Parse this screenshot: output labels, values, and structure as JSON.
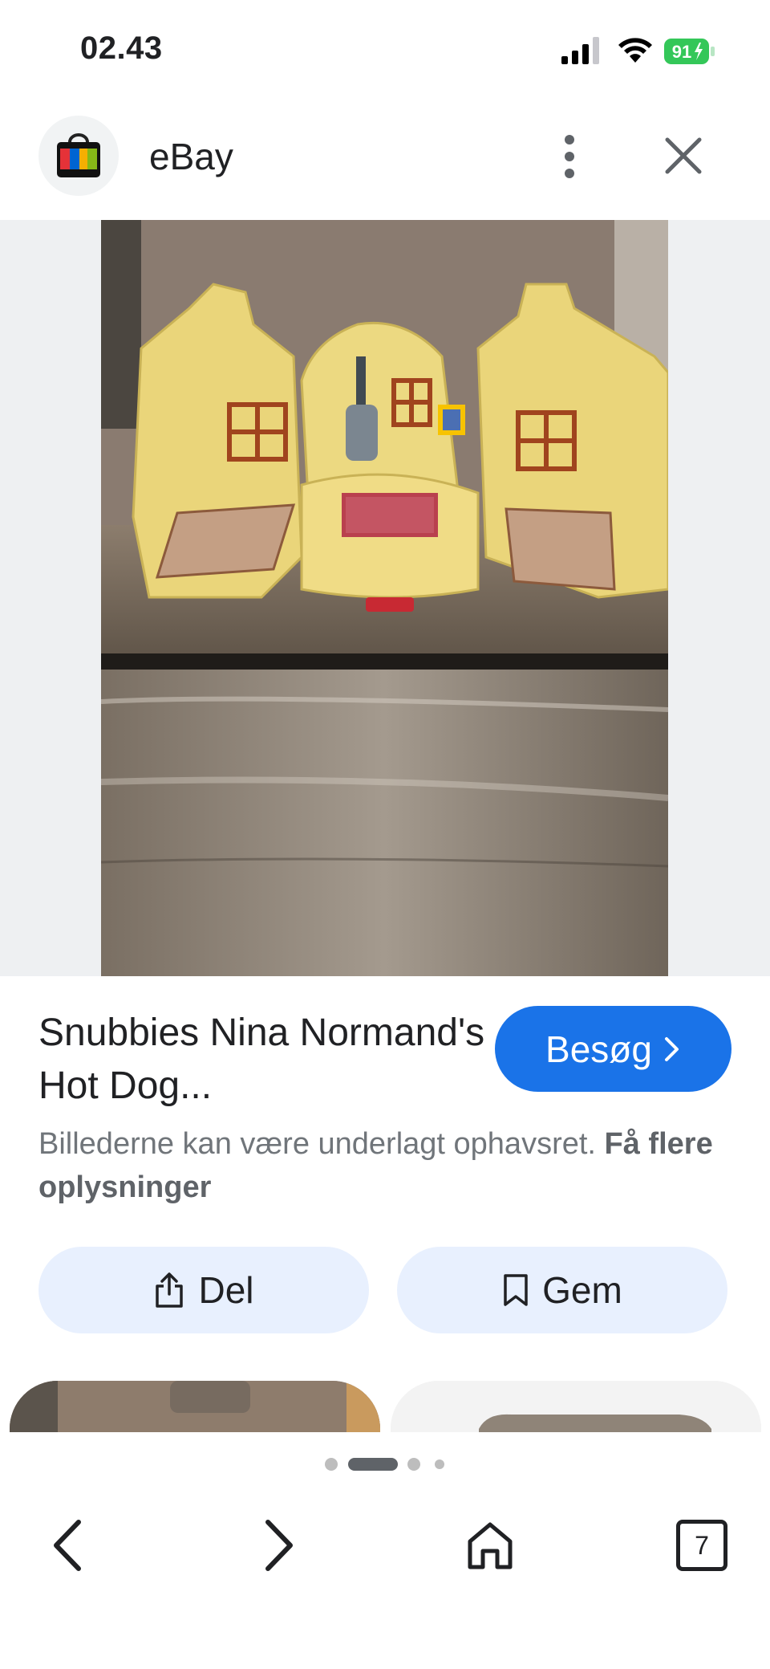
{
  "status_bar": {
    "time": "02.43",
    "battery": "91"
  },
  "header": {
    "site_name": "eBay"
  },
  "product": {
    "title": "Snubbies Nina Normand's Hot Dog...",
    "visit_label": "Besøg",
    "copyright_text": "Billederne kan være underlagt ophavsret.",
    "copyright_link": "Få flere oplysninger"
  },
  "actions": {
    "share_label": "Del",
    "save_label": "Gem"
  },
  "pagination": {
    "current": 2,
    "total": 4
  },
  "bottom_nav": {
    "tabs_count": "7"
  },
  "colors": {
    "accent": "#1a73e8",
    "action_bg": "#e8f0fe",
    "battery_green": "#34c759"
  },
  "icons": [
    "signal-icon",
    "wifi-icon",
    "battery-icon",
    "ebay-bag-icon",
    "more-vert-icon",
    "close-icon",
    "chevron-right-icon",
    "share-icon",
    "bookmark-icon",
    "back-icon",
    "forward-icon",
    "home-icon",
    "tabs-icon"
  ]
}
